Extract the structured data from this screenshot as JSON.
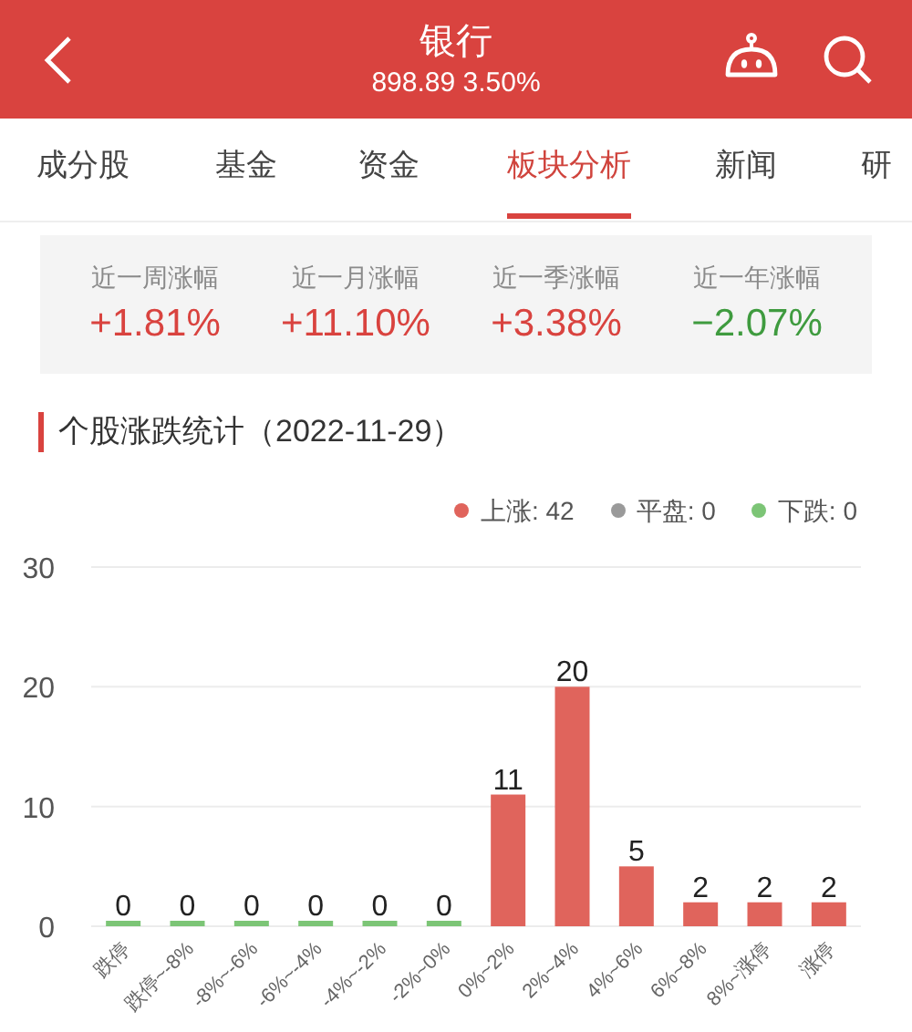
{
  "header": {
    "title": "银行",
    "subtitle": "898.89 3.50%"
  },
  "tabs": [
    {
      "label": "成分股",
      "selected": false
    },
    {
      "label": "基金",
      "selected": false
    },
    {
      "label": "资金",
      "selected": false
    },
    {
      "label": "板块分析",
      "selected": true
    },
    {
      "label": "新闻",
      "selected": false
    },
    {
      "label": "研",
      "selected": false
    }
  ],
  "stats": [
    {
      "label": "近一周涨幅",
      "value": "+1.81%",
      "color": "#d9433f"
    },
    {
      "label": "近一月涨幅",
      "value": "+11.10%",
      "color": "#d9433f"
    },
    {
      "label": "近一季涨幅",
      "value": "+3.38%",
      "color": "#d9433f"
    },
    {
      "label": "近一年涨幅",
      "value": "−2.07%",
      "color": "#3f9b3f"
    }
  ],
  "section": {
    "title": "个股涨跌统计（2022-11-29）"
  },
  "legend": [
    {
      "label": "上涨: 42",
      "color": "#e0645c"
    },
    {
      "label": "平盘: 0",
      "color": "#9a9a9a"
    },
    {
      "label": "下跌: 0",
      "color": "#7cc576"
    }
  ],
  "chart_data": {
    "type": "bar",
    "stacked": true,
    "data_labels": true,
    "categories": [
      "跌停",
      "跌停~-8%",
      "-8%~-6%",
      "-6%~-4%",
      "-4%~-2%",
      "-2%~0%",
      "0%~2%",
      "2%~4%",
      "4%~6%",
      "6%~8%",
      "8%~涨停",
      "涨停"
    ],
    "series": [
      {
        "color": "#7cc576",
        "values": [
          0,
          0,
          0,
          0,
          0,
          0,
          null,
          null,
          null,
          null,
          null,
          null
        ]
      },
      {
        "color": "#e0645c",
        "values": [
          null,
          null,
          null,
          null,
          null,
          null,
          11,
          20,
          5,
          2,
          2,
          2
        ]
      }
    ],
    "ylim": [
      0,
      30
    ],
    "yticks": [
      0,
      10,
      20,
      30
    ]
  }
}
